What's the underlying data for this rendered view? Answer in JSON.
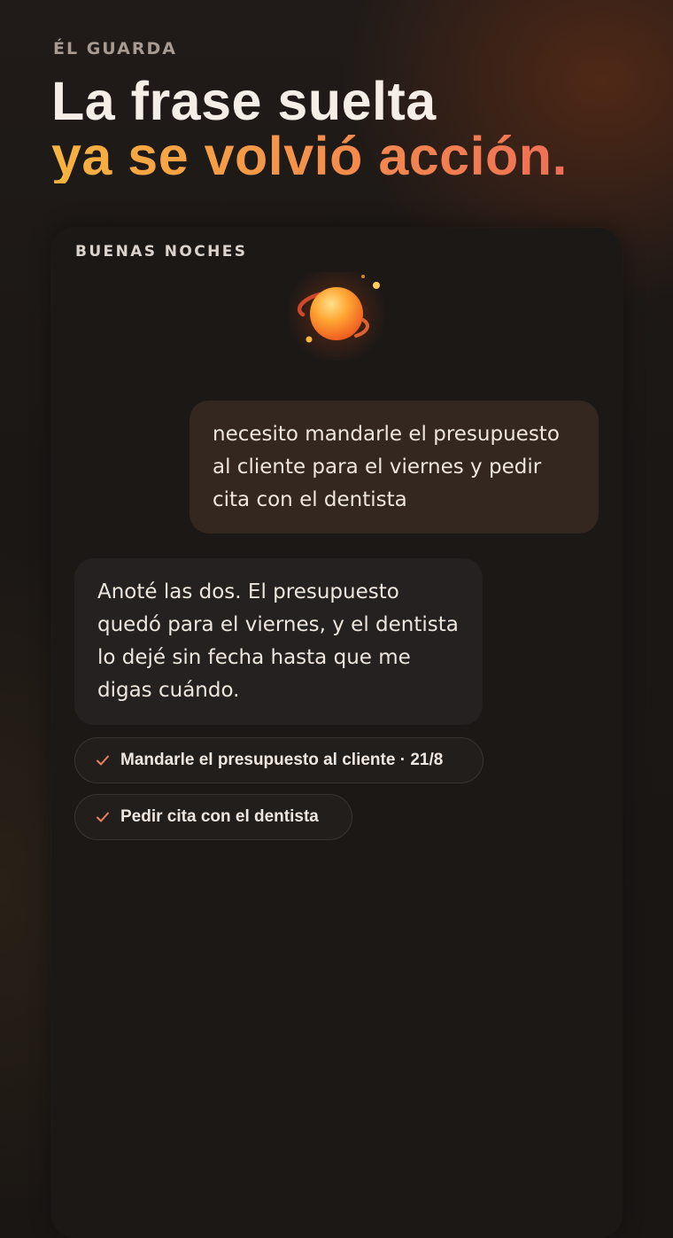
{
  "header": {
    "eyebrow": "ÉL GUARDA",
    "headline_line1": "La frase suelta",
    "headline_line2": "ya se volvió acción."
  },
  "card": {
    "label": "BUENAS NOCHES",
    "avatar_icon": "glowing-planet-icon",
    "messages": {
      "user": "necesito mandarle el presupuesto al cliente para el viernes y pedir cita con el dentista",
      "assistant": "Anoté las dos. El presupuesto quedó para el viernes, y el dentista lo dejé sin fecha hasta que me digas cuándo."
    },
    "tasks": [
      {
        "icon": "check-icon",
        "label": "Mandarle el presupuesto al cliente · 21/8"
      },
      {
        "icon": "check-icon",
        "label": "Pedir cita con el dentista"
      }
    ]
  },
  "colors": {
    "background": "#1a1614",
    "accent_start": "#f7b33f",
    "accent_end": "#ef6f56",
    "user_bubble": "#33271f",
    "assistant_bubble": "#242120",
    "check": "#e9835f"
  }
}
